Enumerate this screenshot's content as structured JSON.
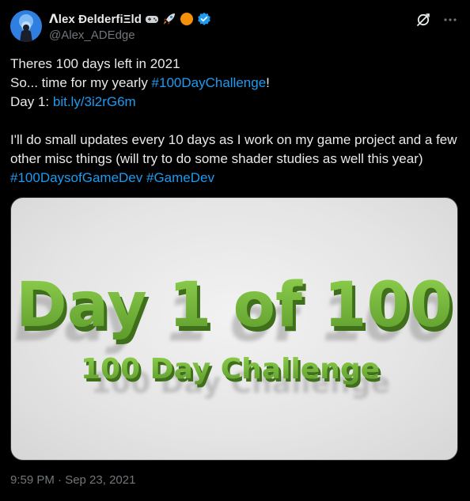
{
  "author": {
    "display_name": "ᐱlex ƉelderfiΞld",
    "handle": "@Alex_ADEdge",
    "badges": [
      "gamepad-icon",
      "rocket-icon",
      "orange-circle-icon",
      "verified-icon"
    ]
  },
  "tweet": {
    "line1": "Theres 100 days left in 2021",
    "line2_prefix": "So... time for my yearly ",
    "line2_hashtag": "#100DayChallenge",
    "line2_suffix": "!",
    "line3_prefix": "Day 1: ",
    "line3_link": "bit.ly/3i2rG6m",
    "para2_text": "I'll do small updates every 10 days as I work on my game project and a few other misc things (will try to do some shader studies as well this year) ",
    "para2_hashtag1": "#100DaysofGameDev",
    "para2_hashtag2": "#GameDev"
  },
  "media": {
    "title": "Day 1 of 100",
    "subtitle": "100 Day Challenge"
  },
  "timestamp": "9:59 PM · Sep 23, 2021",
  "colors": {
    "background": "#000000",
    "text": "#e7e9ea",
    "muted": "#71767b",
    "link": "#1d9bf0",
    "verified": "#1d9bf0",
    "green_text": "#7bbf3a"
  }
}
